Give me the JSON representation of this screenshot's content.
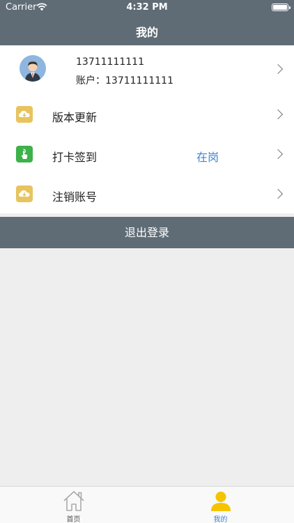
{
  "status_bar": {
    "carrier": "Carrier",
    "time": "4:32 PM"
  },
  "header": {
    "title": "我的"
  },
  "profile": {
    "phone": "13711111111",
    "account": "账户：13711111111"
  },
  "menu_items": [
    {
      "label": "版本更新",
      "icon": "cloud-download-icon",
      "icon_color": "#e8c45f"
    },
    {
      "label": "打卡签到",
      "icon": "tap-hand-icon",
      "icon_color": "#3db14a",
      "status": "在岗",
      "status_color": "#3b86d4"
    },
    {
      "label": "注销账号",
      "icon": "cloud-download-icon",
      "icon_color": "#e8c45f"
    }
  ],
  "logout_label": "退出登录",
  "tabbar": [
    {
      "label": "首页",
      "icon": "home-icon",
      "active": false
    },
    {
      "label": "我的",
      "icon": "user-icon",
      "active": true,
      "active_color": "#f5c400"
    }
  ]
}
